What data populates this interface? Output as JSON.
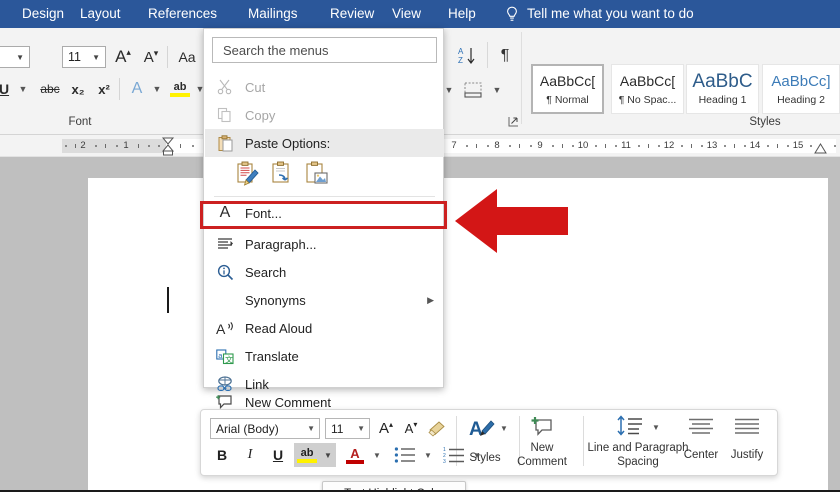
{
  "window": {
    "accent_color": "#2b579a",
    "ribbon_bg": "#f3f3f3",
    "highlight_color": "#cc2020"
  },
  "tabbar": {
    "tabs": [
      {
        "label": "Design"
      },
      {
        "label": "Layout"
      },
      {
        "label": "References"
      },
      {
        "label": "Mailings"
      },
      {
        "label": "Review"
      },
      {
        "label": "View"
      },
      {
        "label": "Help"
      }
    ],
    "tellme": {
      "icon": "lightbulb-icon",
      "label": "Tell me what you want to do"
    }
  },
  "ribbon": {
    "font_group": {
      "label": "Font",
      "font_name_value": ")",
      "font_size_value": "11",
      "grow_font": "A",
      "shrink_font": "A",
      "change_case": "Aa",
      "underline": "U",
      "strikethrough": "abc",
      "subscript": "x₂",
      "superscript": "x²",
      "text_effects": "A",
      "text_highlight": "ab"
    },
    "paragraph_group": {
      "sort": "AZ",
      "show_marks": "¶",
      "borders": "borders-icon"
    },
    "styles_group": {
      "label": "Styles",
      "items": [
        {
          "preview": "AaBbCc[",
          "name": "¶ Normal",
          "selected": true,
          "kind": "sans"
        },
        {
          "preview": "AaBbCc[",
          "name": "¶ No Spac...",
          "selected": false,
          "kind": "sans"
        },
        {
          "preview": "AaBbC",
          "name": "Heading 1",
          "selected": false,
          "kind": "h1"
        },
        {
          "preview": "AaBbCc]",
          "name": "Heading 2",
          "selected": false,
          "kind": "h2"
        }
      ]
    }
  },
  "ruler": {
    "left_numbers": [
      "2",
      "1"
    ],
    "right_numbers": [
      "7",
      "8",
      "9",
      "10",
      "11",
      "12",
      "13",
      "14",
      "15"
    ]
  },
  "context_menu": {
    "search_placeholder": "Search the menus",
    "items": [
      {
        "label": "Cut",
        "icon": "scissors-icon",
        "disabled": true,
        "underline": "t",
        "submenu": false
      },
      {
        "label": "Copy",
        "icon": "copy-icon",
        "disabled": true,
        "underline": "C",
        "submenu": false
      },
      {
        "label": "Paste Options:",
        "icon": "clipboard-icon",
        "disabled": false,
        "header": true,
        "submenu": false
      },
      {
        "label": "Font...",
        "icon": "font-letter-a-icon",
        "disabled": false,
        "underline": "F",
        "submenu": false
      },
      {
        "label": "Paragraph...",
        "icon": "paragraph-icon",
        "disabled": false,
        "underline": "P",
        "submenu": false,
        "highlighted": true
      },
      {
        "label": "Search",
        "icon": "search-info-icon",
        "disabled": false,
        "underline": "c",
        "submenu": false
      },
      {
        "label": "Synonyms",
        "icon": "none",
        "disabled": false,
        "underline": "y",
        "submenu": true
      },
      {
        "label": "Read Aloud",
        "icon": "read-aloud-icon",
        "disabled": false,
        "underline": "R",
        "submenu": false
      },
      {
        "label": "Translate",
        "icon": "translate-icon",
        "disabled": false,
        "underline": "a",
        "submenu": false
      },
      {
        "label": "Link",
        "icon": "link-icon",
        "disabled": false,
        "underline": "i",
        "submenu": false
      },
      {
        "label": "New Comment",
        "icon": "new-comment-icon",
        "disabled": false,
        "underline": "m",
        "submenu": false
      }
    ],
    "paste_options": [
      {
        "name": "keep-source-formatting-icon"
      },
      {
        "name": "merge-formatting-icon"
      },
      {
        "name": "picture-icon"
      }
    ]
  },
  "mini_toolbar": {
    "font_name_value": "Arial (Body)",
    "font_size_value": "11",
    "grow_font": "A",
    "shrink_font": "A",
    "format_painter": "format-painter-icon",
    "styles_label": "Styles",
    "bold": "B",
    "italic": "I",
    "underline": "U",
    "highlight": "ab",
    "font_color": "A",
    "bullets": "bullets-icon",
    "numbering": "numbering-icon",
    "new_comment_label_line1": "New",
    "new_comment_label_line2": "Comment",
    "line_spacing_label_line1": "Line and Paragraph",
    "line_spacing_label_line2": "Spacing",
    "center_label": "Center",
    "justify_label": "Justify"
  },
  "tooltip": {
    "text": "Text Highlight Color"
  }
}
